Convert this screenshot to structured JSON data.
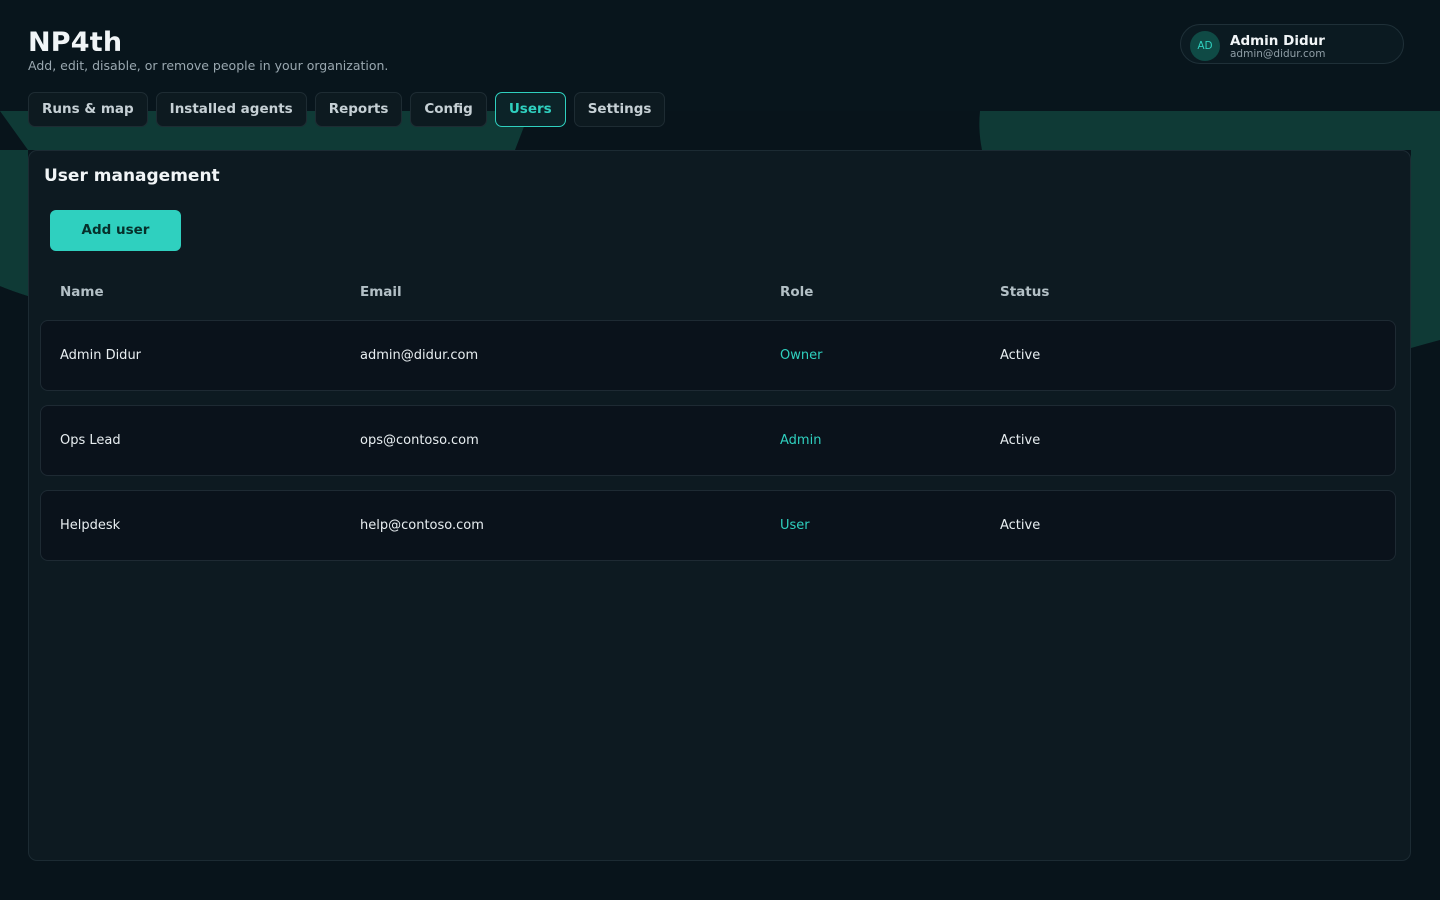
{
  "app": {
    "title": "NP4th",
    "subtitle": "Add, edit, disable, or remove people in your organization."
  },
  "user": {
    "initials": "AD",
    "name": "Admin Didur",
    "email": "admin@didur.com"
  },
  "tabs": [
    {
      "label": "Runs & map",
      "active": false
    },
    {
      "label": "Installed agents",
      "active": false
    },
    {
      "label": "Reports",
      "active": false
    },
    {
      "label": "Config",
      "active": false
    },
    {
      "label": "Users",
      "active": true
    },
    {
      "label": "Settings",
      "active": false
    }
  ],
  "panel": {
    "title": "User management",
    "add_button": "Add user",
    "columns": [
      "Name",
      "Email",
      "Role",
      "Status"
    ],
    "rows": [
      {
        "name": "Admin Didur",
        "email": "admin@didur.com",
        "role": "Owner",
        "status": "Active"
      },
      {
        "name": "Ops Lead",
        "email": "ops@contoso.com",
        "role": "Admin",
        "status": "Active"
      },
      {
        "name": "Helpdesk",
        "email": "help@contoso.com",
        "role": "User",
        "status": "Active"
      }
    ]
  },
  "colors": {
    "accent": "#2fd0bf",
    "background": "#08141b",
    "panel": "#0d1a21",
    "decor": "#0f3a36"
  }
}
